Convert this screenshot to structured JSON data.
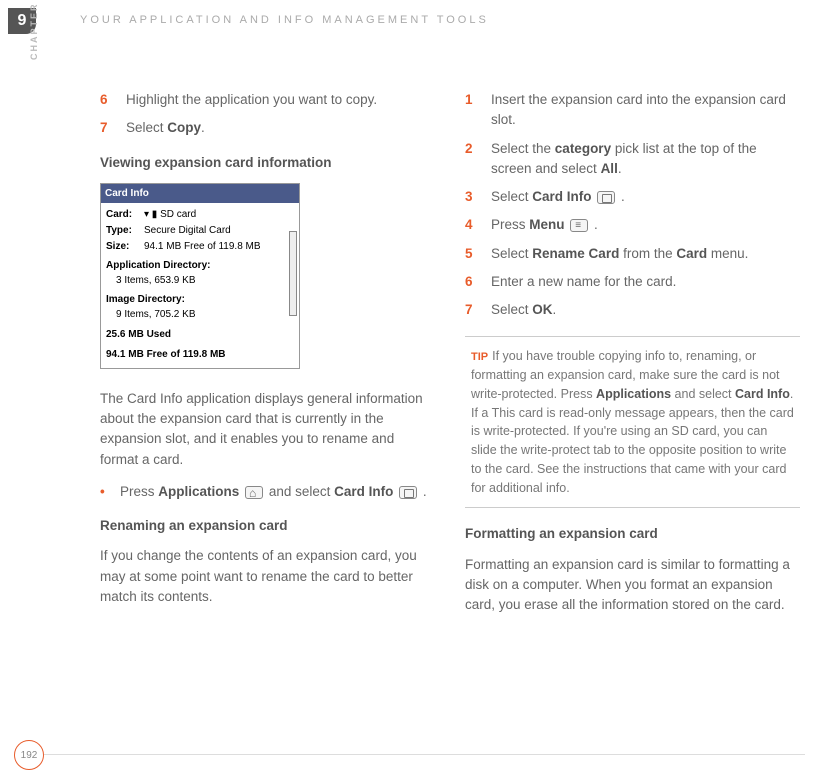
{
  "chapter": {
    "number": "9",
    "label": "CHAPTER"
  },
  "header": {
    "title": "YOUR APPLICATION AND INFO MANAGEMENT TOOLS"
  },
  "left": {
    "step6": {
      "num": "6",
      "text": "Highlight the application you want to copy."
    },
    "step7": {
      "num": "7",
      "pre": "Select ",
      "bold": "Copy",
      "post": "."
    },
    "section1": "Viewing expansion card information",
    "screenshot": {
      "title": "Card Info",
      "card_label": "Card:",
      "card_val": "▾ ▮ SD card",
      "type_label": "Type:",
      "type_val": "Secure Digital Card",
      "size_label": "Size:",
      "size_val": "94.1 MB Free of 119.8 MB",
      "appdir": "Application Directory:",
      "appdir_val": "3 Items, 653.9 KB",
      "imgdir": "Image Directory:",
      "imgdir_val": "9 Items, 705.2 KB",
      "used": "25.6 MB Used",
      "free": "94.1 MB Free of 119.8 MB"
    },
    "para1": "The Card Info application displays general information about the expansion card that is currently in the expansion slot, and it enables you to rename and format a card.",
    "bullet1": {
      "pre": "Press ",
      "b1": "Applications",
      "mid": " and select ",
      "b2": "Card Info",
      "post": " ."
    },
    "section2": "Renaming an expansion card",
    "para2": "If you change the contents of an expansion card, you may at some point want to rename the card to better match its contents."
  },
  "right": {
    "step1": {
      "num": "1",
      "text": "Insert the expansion card into the expansion card slot."
    },
    "step2": {
      "num": "2",
      "pre": "Select the ",
      "b1": "category",
      "mid": " pick list at the top of the screen and select ",
      "b2": "All",
      "post": "."
    },
    "step3": {
      "num": "3",
      "pre": "Select ",
      "b1": "Card Info",
      "post": " ."
    },
    "step4": {
      "num": "4",
      "pre": "Press ",
      "b1": "Menu",
      "post": " ."
    },
    "step5": {
      "num": "5",
      "pre": "Select ",
      "b1": "Rename Card",
      "mid": " from the ",
      "b2": "Card",
      "post": " menu."
    },
    "step6": {
      "num": "6",
      "text": "Enter a new name for the card."
    },
    "step7": {
      "num": "7",
      "pre": "Select ",
      "b1": "OK",
      "post": "."
    },
    "tip": {
      "label": "TIP",
      "pre": "If you have trouble copying info to, renaming, or formatting an expansion card, make sure the card is not write-protected. Press ",
      "b1": "Applications",
      "mid1": " and select ",
      "b2": "Card Info",
      "post": ". If a This card is read-only message appears, then the card is write-protected. If you're using an SD card, you can slide the write-protect tab to the opposite position to write to the card. See the instructions that came with your card for additional info."
    },
    "section1": "Formatting an expansion card",
    "para1": "Formatting an expansion card is similar to formatting a disk on a computer. When you format an expansion card, you erase all the information stored on the card."
  },
  "page": "192"
}
